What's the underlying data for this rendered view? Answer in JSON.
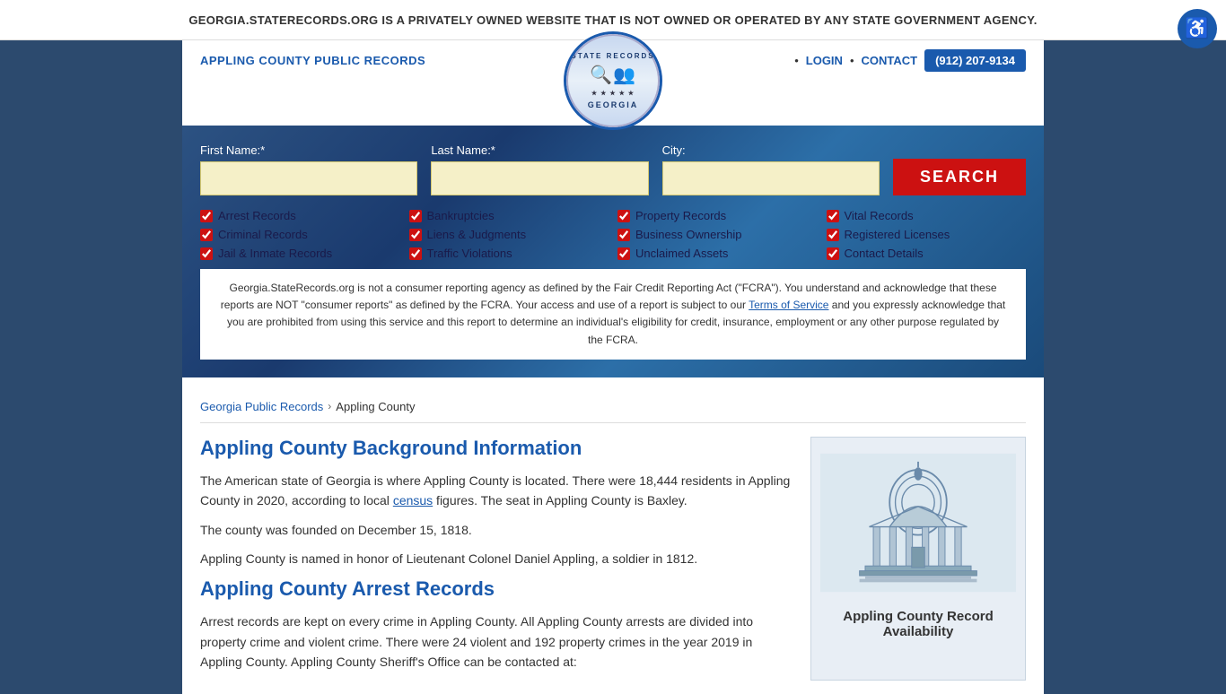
{
  "banner": {
    "text": "GEORGIA.STATERECORDS.ORG IS A PRIVATELY OWNED WEBSITE THAT IS NOT OWNED OR OPERATED BY ANY STATE GOVERNMENT AGENCY.",
    "close_label": "×"
  },
  "accessibility": {
    "icon": "♿"
  },
  "header": {
    "site_title": "APPLING COUNTY PUBLIC RECORDS",
    "logo_top": "STATE RECORDS",
    "logo_bottom": "GEORGIA",
    "nav_login": "LOGIN",
    "nav_contact": "CONTACT",
    "nav_phone": "(912) 207-9134",
    "nav_dot": "•"
  },
  "search": {
    "first_name_label": "First Name:*",
    "last_name_label": "Last Name:*",
    "city_label": "City:",
    "search_button": "SEARCH",
    "checkboxes": [
      {
        "col": 0,
        "label": "Arrest Records",
        "checked": true
      },
      {
        "col": 0,
        "label": "Criminal Records",
        "checked": true
      },
      {
        "col": 0,
        "label": "Jail & Inmate Records",
        "checked": true
      },
      {
        "col": 1,
        "label": "Bankruptcies",
        "checked": true
      },
      {
        "col": 1,
        "label": "Liens & Judgments",
        "checked": true
      },
      {
        "col": 1,
        "label": "Traffic Violations",
        "checked": true
      },
      {
        "col": 2,
        "label": "Property Records",
        "checked": true
      },
      {
        "col": 2,
        "label": "Business Ownership",
        "checked": true
      },
      {
        "col": 2,
        "label": "Unclaimed Assets",
        "checked": true
      },
      {
        "col": 3,
        "label": "Vital Records",
        "checked": true
      },
      {
        "col": 3,
        "label": "Registered Licenses",
        "checked": true
      },
      {
        "col": 3,
        "label": "Contact Details",
        "checked": true
      }
    ],
    "disclaimer": "Georgia.StateRecords.org is not a consumer reporting agency as defined by the Fair Credit Reporting Act (\"FCRA\"). You understand and acknowledge that these reports are NOT \"consumer reports\" as defined by the FCRA. Your access and use of a report is subject to our Terms of Service and you expressly acknowledge that you are prohibited from using this service and this report to determine an individual's eligibility for credit, insurance, employment or any other purpose regulated by the FCRA.",
    "disclaimer_link": "Terms of Service"
  },
  "breadcrumb": {
    "parent": "Georgia Public Records",
    "current": "Appling County"
  },
  "content": {
    "main_title": "Appling County Background Information",
    "paragraphs": [
      "The American state of Georgia is where Appling County is located. There were 18,444 residents in Appling County in 2020, according to local census figures. The seat in Appling County is Baxley.",
      "The county was founded on December 15, 1818.",
      "Appling County is named in honor of Lieutenant Colonel Daniel Appling, a soldier in 1812."
    ],
    "arrest_title": "Appling County Arrest Records",
    "arrest_paragraph": "Arrest records are kept on every crime in Appling County. All Appling County arrests are divided into property crime and violent crime. There were 24 violent and 192 property crimes in the year 2019 in Appling County. Appling County Sheriff's Office can be contacted at:"
  },
  "sidebar": {
    "caption": "Appling County Record Availability"
  }
}
